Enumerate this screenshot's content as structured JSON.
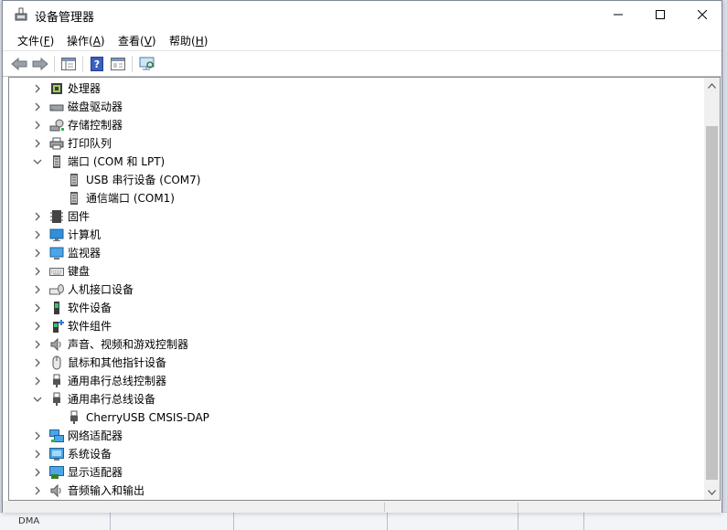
{
  "window": {
    "title": "设备管理器",
    "controls": {
      "minimize": "minimize",
      "maximize": "maximize",
      "close": "close"
    }
  },
  "menu": [
    {
      "text": "文件(",
      "key": "F",
      "end": ")"
    },
    {
      "text": "操作(",
      "key": "A",
      "end": ")"
    },
    {
      "text": "查看(",
      "key": "V",
      "end": ")"
    },
    {
      "text": "帮助(",
      "key": "H",
      "end": ")"
    }
  ],
  "toolbar": [
    "back-arrow-icon",
    "forward-arrow-icon",
    "show-hide-console-tree-icon",
    "help-icon",
    "properties-icon",
    "scan-hardware-icon"
  ],
  "tree": {
    "items": [
      {
        "label": "处理器",
        "icon": "processor-icon",
        "expanded": false,
        "level": 0
      },
      {
        "label": "磁盘驱动器",
        "icon": "disk-drive-icon",
        "expanded": false,
        "level": 0
      },
      {
        "label": "存储控制器",
        "icon": "storage-controller-icon",
        "expanded": false,
        "level": 0
      },
      {
        "label": "打印队列",
        "icon": "printer-icon",
        "expanded": false,
        "level": 0
      },
      {
        "label": "端口 (COM 和 LPT)",
        "icon": "port-icon",
        "expanded": true,
        "level": 0
      },
      {
        "label": "USB 串行设备 (COM7)",
        "icon": "port-icon",
        "level": 1
      },
      {
        "label": "通信端口 (COM1)",
        "icon": "port-icon",
        "level": 1
      },
      {
        "label": "固件",
        "icon": "firmware-icon",
        "expanded": false,
        "level": 0
      },
      {
        "label": "计算机",
        "icon": "computer-icon",
        "expanded": false,
        "level": 0
      },
      {
        "label": "监视器",
        "icon": "monitor-icon",
        "expanded": false,
        "level": 0
      },
      {
        "label": "键盘",
        "icon": "keyboard-icon",
        "expanded": false,
        "level": 0
      },
      {
        "label": "人机接口设备",
        "icon": "hid-icon",
        "expanded": false,
        "level": 0
      },
      {
        "label": "软件设备",
        "icon": "software-device-icon",
        "expanded": false,
        "level": 0
      },
      {
        "label": "软件组件",
        "icon": "software-component-icon",
        "expanded": false,
        "level": 0
      },
      {
        "label": "声音、视频和游戏控制器",
        "icon": "speaker-icon",
        "expanded": false,
        "level": 0
      },
      {
        "label": "鼠标和其他指针设备",
        "icon": "mouse-icon",
        "expanded": false,
        "level": 0
      },
      {
        "label": "通用串行总线控制器",
        "icon": "usb-icon",
        "expanded": false,
        "level": 0
      },
      {
        "label": "通用串行总线设备",
        "icon": "usb-icon",
        "expanded": true,
        "level": 0
      },
      {
        "label": "CherryUSB CMSIS-DAP",
        "icon": "usb-icon",
        "level": 1
      },
      {
        "label": "网络适配器",
        "icon": "network-adapter-icon",
        "expanded": false,
        "level": 0
      },
      {
        "label": "系统设备",
        "icon": "system-device-icon",
        "expanded": false,
        "level": 0
      },
      {
        "label": "显示适配器",
        "icon": "display-adapter-icon",
        "expanded": false,
        "level": 0
      },
      {
        "label": "音频输入和输出",
        "icon": "audio-io-icon",
        "expanded": false,
        "level": 0
      }
    ]
  },
  "background": {
    "visible_text": "DMA"
  }
}
